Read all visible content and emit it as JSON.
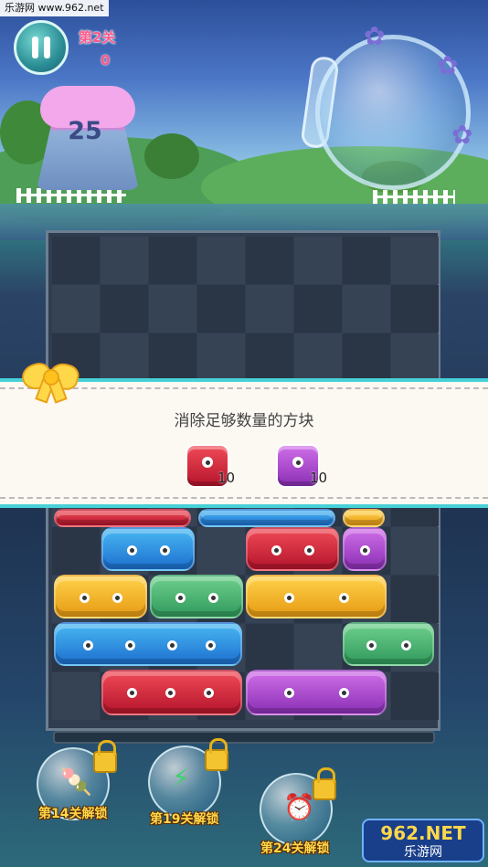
{
  "watermark": "乐游网 www.962.net",
  "hud": {
    "level_label": "第2关",
    "score": "0",
    "moves_left": "25",
    "pause_icon": "pause-icon"
  },
  "goal": {
    "title": "消除足够数量的方块",
    "items": [
      {
        "color": "red",
        "count": "10"
      },
      {
        "color": "purple",
        "count": "10"
      }
    ]
  },
  "boosters": [
    {
      "icon": "popsicle-icon",
      "label": "第14关解锁",
      "locked": true
    },
    {
      "icon": "lightning-icon",
      "label": "第19关解锁",
      "locked": true
    },
    {
      "icon": "alarm-bomb-icon",
      "label": "第24关解锁",
      "locked": true
    }
  ],
  "logo": {
    "top": "962.NET",
    "bottom": "乐游网"
  },
  "colors": {
    "red": "#d8293c",
    "blue": "#2f8fe0",
    "green": "#4bb574",
    "yellow": "#f5b82a",
    "purple": "#b04bd6",
    "accent": "#46d1d7",
    "level_text": "#ff5a8a"
  }
}
